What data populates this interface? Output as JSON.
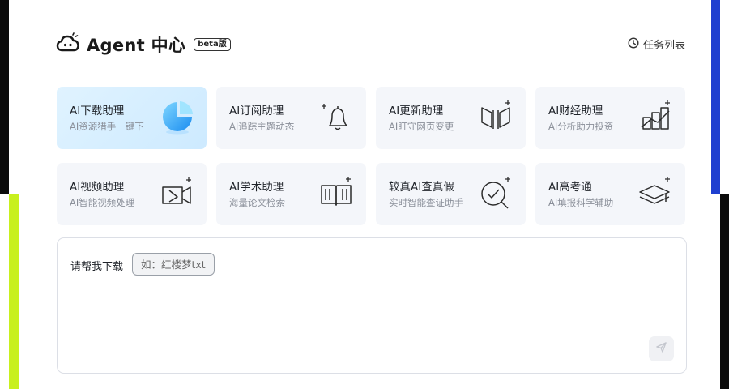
{
  "header": {
    "title": "Agent 中心",
    "badge": "beta版",
    "task_list_label": "任务列表"
  },
  "cards": [
    {
      "title": "AI下载助理",
      "subtitle": "AI资源猎手一键下",
      "icon": "download-sphere-icon",
      "active": true
    },
    {
      "title": "AI订阅助理",
      "subtitle": "AI追踪主题动态",
      "icon": "bell-icon"
    },
    {
      "title": "AI更新助理",
      "subtitle": "AI盯守网页变更",
      "icon": "update-icon"
    },
    {
      "title": "AI财经助理",
      "subtitle": "AI分析助力投资",
      "icon": "finance-chart-icon"
    },
    {
      "title": "AI视频助理",
      "subtitle": "AI智能视频处理",
      "icon": "video-icon"
    },
    {
      "title": "AI学术助理",
      "subtitle": "海量论文检索",
      "icon": "book-icon"
    },
    {
      "title": "较真AI查真假",
      "subtitle": "实时智能查证助手",
      "icon": "verify-magnifier-icon"
    },
    {
      "title": "AI高考通",
      "subtitle": "AI填报科学辅助",
      "icon": "graduation-cap-icon"
    }
  ],
  "input": {
    "label": "请帮我下载",
    "suggestion": "如：红楼梦txt"
  },
  "colors": {
    "accent_blue": "#1f3fd0",
    "accent_lime": "#c8f01e",
    "card_bg": "#f4f6fa",
    "active_card_bg": "#d6eeff"
  }
}
